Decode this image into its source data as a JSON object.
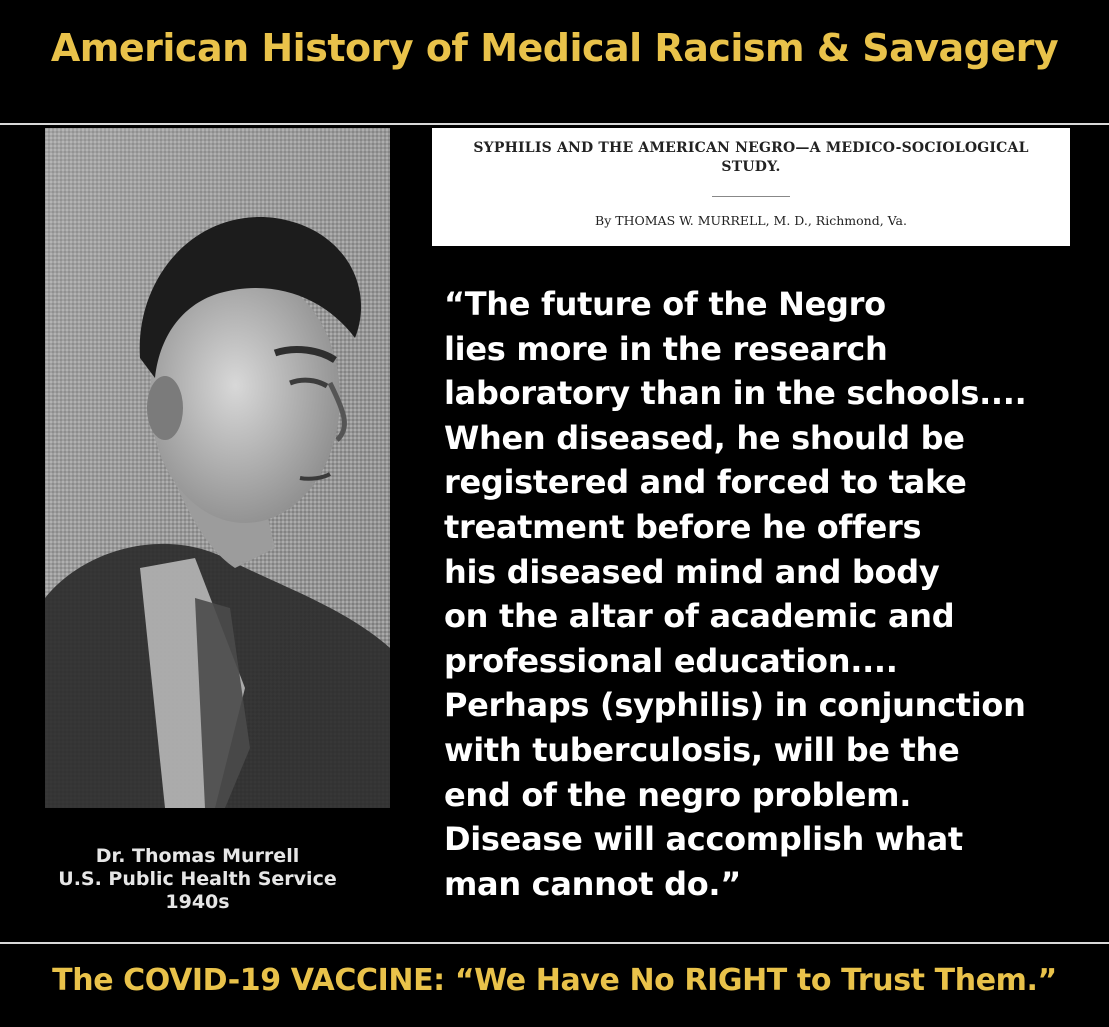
{
  "title": "American History of Medical Racism & Savagery",
  "clipping": {
    "title_line1": "SYPHILIS AND THE AMERICAN NEGRO—A MEDICO-SOCIOLOGICAL",
    "title_line2": "STUDY.",
    "byline": "By THOMAS W. MURRELL, M. D., Richmond, Va."
  },
  "quote": {
    "lines": [
      "“The future of the Negro",
      "lies more in the research",
      "laboratory than in the schools....",
      "When diseased, he should be",
      "registered and forced to take",
      "treatment before he offers",
      "his diseased mind and body",
      "on the altar of academic and",
      "professional education....",
      "Perhaps (syphilis) in conjunction",
      "with tuberculosis, will be the",
      "end of the negro problem.",
      "Disease will accomplish what",
      "man cannot do.”"
    ]
  },
  "caption": {
    "line1": "Dr. Thomas Murrell",
    "line2": "U.S. Public Health Service",
    "line3": "1940s"
  },
  "footer": "The COVID-19 VACCINE: “We Have No RIGHT to Trust Them.”",
  "colors": {
    "background": "#000000",
    "gold": "#e9c24a",
    "text": "#ffffff",
    "rule": "#d9d9d9"
  }
}
